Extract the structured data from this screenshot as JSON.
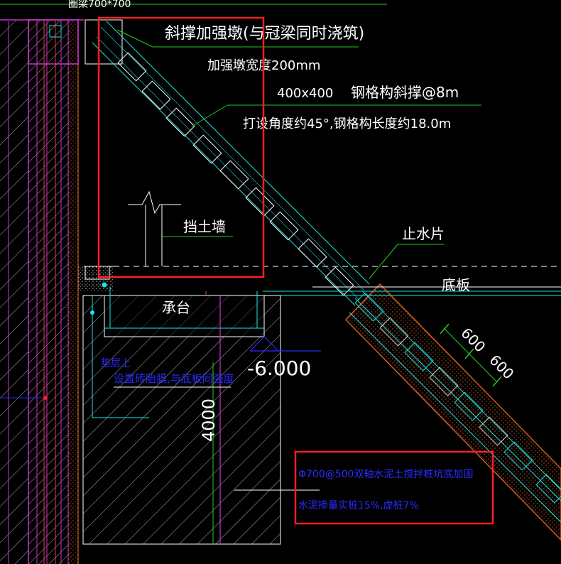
{
  "labels": {
    "top_cut": "圈梁700*700",
    "brace_pier": "斜撑加强墩(与冠梁同时浇筑)",
    "pier_width": "加强墩宽度200mm",
    "steel_size": "400x400",
    "steel_brace": "钢格构斜撑@8m",
    "angle_length": "打设角度约45°,钢格构长度约18.0m",
    "retaining_wall": "挡土墙",
    "water_stop": "止水片",
    "floor_slab": "底板",
    "pile_cap": "承台",
    "elevation": "-6.000",
    "dim_600_a": "600",
    "dim_600_b": "600",
    "dim_4000": "4000",
    "blue_note_1": "垫层上",
    "blue_note_2": "设置砖胎膜,与底板同强度",
    "reinf_note_1": "Φ700@500双轴水泥土搅拌桩坑底加固",
    "reinf_note_2": "水泥掺量实桩15%,虚桩7%"
  },
  "colors": {
    "background": "#000000",
    "cyan": "#19e6e6",
    "white": "#ffffff",
    "green": "#22cc22",
    "magenta": "#cc33cc",
    "blue": "#2a2aff",
    "red_frame": "#ff2020",
    "orange": "#d05a1e"
  }
}
